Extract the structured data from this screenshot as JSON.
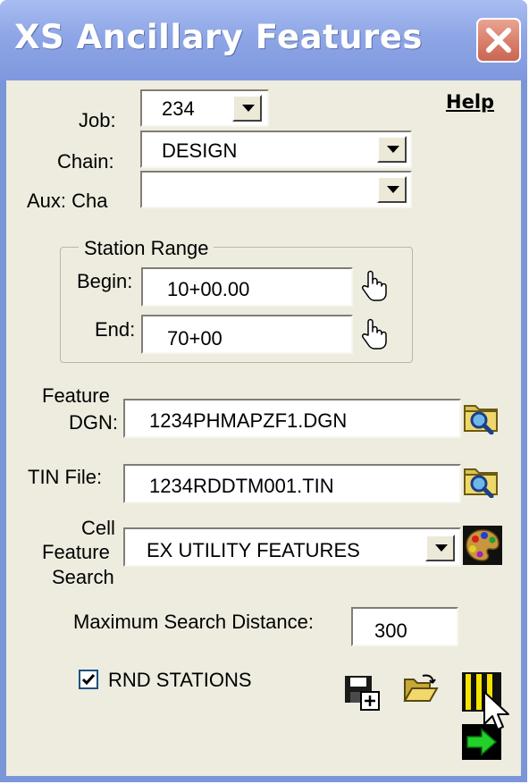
{
  "window": {
    "title": "XS Ancillary Features"
  },
  "help_label": "Help",
  "job": {
    "label": "Job:",
    "value": "234"
  },
  "chain": {
    "label": "Chain:",
    "value": "DESIGN"
  },
  "aux_chain": {
    "label": "Aux: Cha",
    "value": ""
  },
  "station_range": {
    "title": "Station Range",
    "begin_label": "Begin:",
    "begin_value": "10+00.00",
    "end_label": "End:",
    "end_value": "70+00"
  },
  "feature_dgn": {
    "label_line1": "Feature",
    "label_line2": "DGN:",
    "value": "1234PHMAPZF1.DGN"
  },
  "tin_file": {
    "label": "TIN File:",
    "value": "1234RDDTM001.TIN"
  },
  "cell_feature_search": {
    "label_line1": "Cell",
    "label_line2": "Feature",
    "label_line3": "Search",
    "value": "EX UTILITY FEATURES"
  },
  "max_search_distance": {
    "label": "Maximum Search Distance:",
    "value": "300"
  },
  "rnd_stations": {
    "label": "RND STATIONS",
    "checked": true
  },
  "icons": [
    "close-icon",
    "pointer-hand-icon",
    "folder-search-icon",
    "palette-icon",
    "save-new-icon",
    "open-folder-icon",
    "run-icon",
    "green-arrow-icon",
    "mouse-cursor-icon"
  ]
}
